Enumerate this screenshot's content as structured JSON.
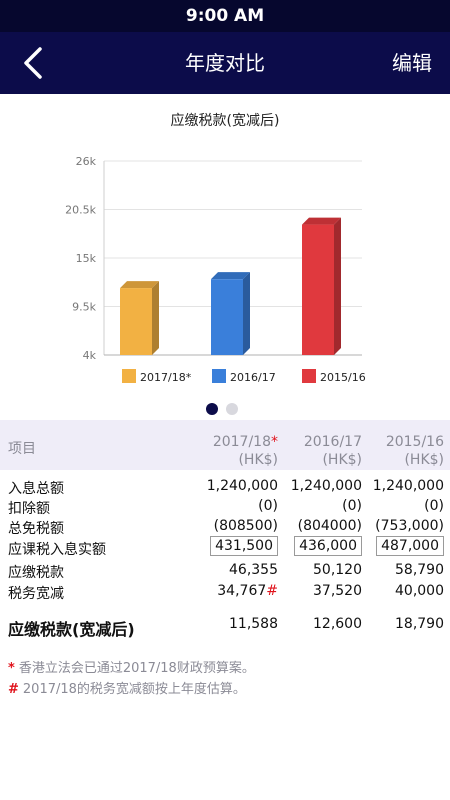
{
  "status_bar": {
    "time": "9:00 AM"
  },
  "nav": {
    "title": "年度对比",
    "edit_label": "编辑"
  },
  "chart_data": {
    "type": "bar",
    "title": "应缴税款(宽减后)",
    "categories": [
      "2017/18*",
      "2016/17",
      "2015/16"
    ],
    "values": [
      11588,
      12600,
      18790
    ],
    "colors": [
      "#f2b143",
      "#3a7fda",
      "#e0393e"
    ],
    "y_ticks": [
      "4k",
      "9.5k",
      "15k",
      "20.5k",
      "26k"
    ],
    "y_tick_values": [
      4000,
      9500,
      15000,
      20500,
      26000
    ],
    "ylim": [
      4000,
      26000
    ],
    "grid": true,
    "legend": [
      "2017/18*",
      "2016/17",
      "2015/16"
    ],
    "legend_position": "bottom"
  },
  "pager": {
    "pages": 2,
    "active": 0
  },
  "table": {
    "header": {
      "item": "项目",
      "years": [
        {
          "year": "2017/18",
          "mark": "*",
          "unit": "(HK$)"
        },
        {
          "year": "2016/17",
          "mark": "",
          "unit": "(HK$)"
        },
        {
          "year": "2015/16",
          "mark": "",
          "unit": "(HK$)"
        }
      ]
    },
    "rows": [
      {
        "label": "入息总额",
        "values": [
          "1,240,000",
          "1,240,000",
          "1,240,000"
        ]
      },
      {
        "label": "扣除额",
        "values": [
          "(0)",
          "(0)",
          "(0)"
        ]
      },
      {
        "label": "总免税额",
        "values": [
          "(808500)",
          "(804000)",
          "(753,000)"
        ]
      },
      {
        "label": "应课税入息实额",
        "values": [
          "431,500",
          "436,000",
          "487,000"
        ]
      },
      {
        "label": "应缴税款",
        "values": [
          "46,355",
          "50,120",
          "58,790"
        ]
      },
      {
        "label": "税务宽减",
        "values": [
          "34,767",
          "37,520",
          "40,000"
        ],
        "mark": "#"
      },
      {
        "label": "应缴税款(宽减后)",
        "values": [
          "11,588",
          "12,600",
          "18,790"
        ]
      }
    ]
  },
  "footnotes": [
    {
      "mark": "*",
      "text": "香港立法会已通过2017/18财政预算案。"
    },
    {
      "mark": "#",
      "text": "2017/18的税务宽减额按上年度估算。"
    }
  ]
}
